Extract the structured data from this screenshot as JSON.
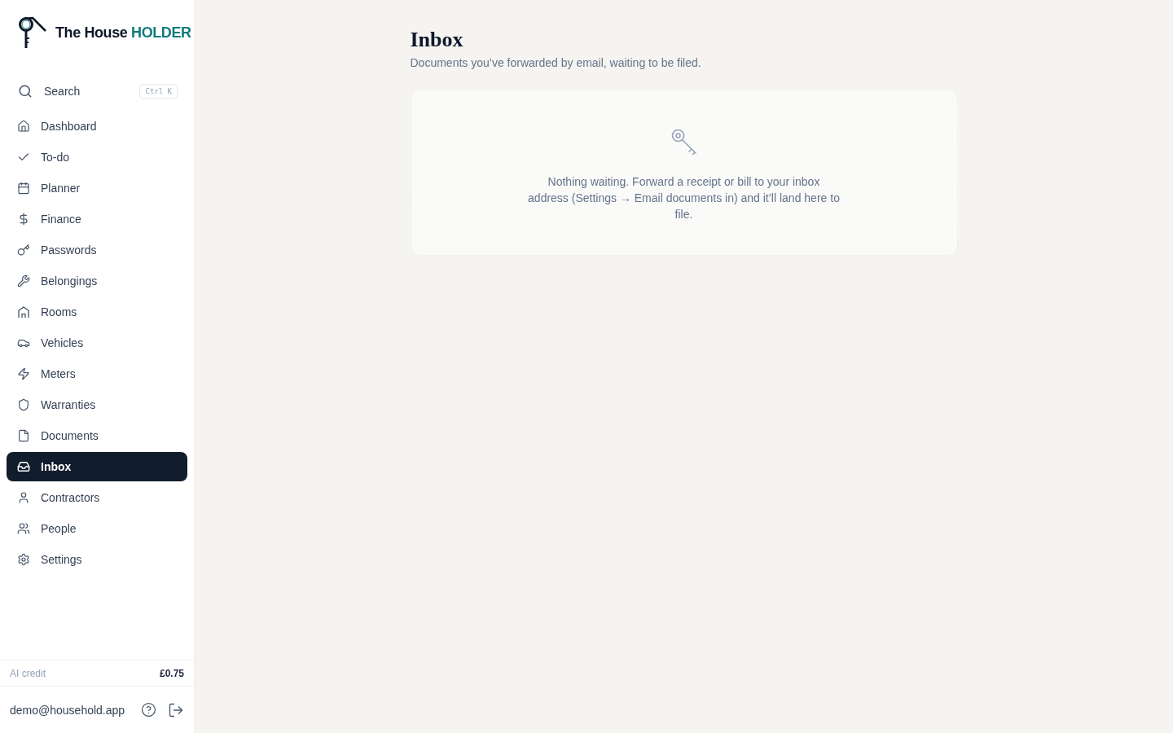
{
  "brand": {
    "name": "The House",
    "accent": "HOLDER"
  },
  "search": {
    "label": "Search",
    "shortcut": "Ctrl K"
  },
  "nav": [
    {
      "label": "Dashboard",
      "selected": false
    },
    {
      "label": "To-do",
      "selected": false
    },
    {
      "label": "Planner",
      "selected": false
    },
    {
      "label": "Finance",
      "selected": false
    },
    {
      "label": "Passwords",
      "selected": false
    },
    {
      "label": "Belongings",
      "selected": false
    },
    {
      "label": "Rooms",
      "selected": false
    },
    {
      "label": "Vehicles",
      "selected": false
    },
    {
      "label": "Meters",
      "selected": false
    },
    {
      "label": "Warranties",
      "selected": false
    },
    {
      "label": "Documents",
      "selected": false
    },
    {
      "label": "Inbox",
      "selected": true
    },
    {
      "label": "Contractors",
      "selected": false
    },
    {
      "label": "People",
      "selected": false
    },
    {
      "label": "Settings",
      "selected": false
    }
  ],
  "footer": {
    "credit_label": "AI credit",
    "credit_value": "£0.75",
    "email": "demo@household.app"
  },
  "page": {
    "title": "Inbox",
    "subtitle": "Documents you’ve forwarded by email, waiting to be filed."
  },
  "empty_state": {
    "message": "Nothing waiting. Forward a receipt or bill to your inbox address (Settings → Email documents in) and it’ll land here to file."
  }
}
